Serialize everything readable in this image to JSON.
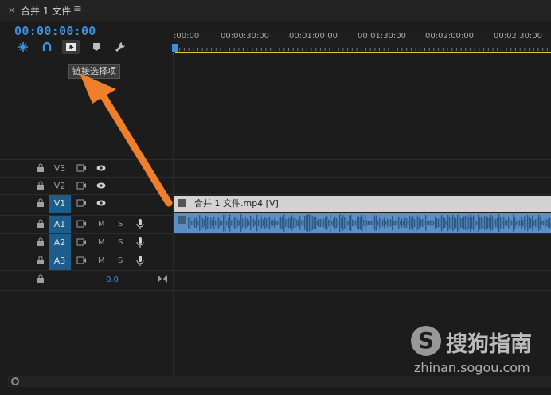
{
  "panel": {
    "close_glyph": "×",
    "sequence_title": "合并 1 文件",
    "menu_glyph": "≡",
    "timecode": "00:00:00:00"
  },
  "toolbar": {
    "icons": [
      "snap-icon",
      "ripple-magnet-icon",
      "linked-selection-icon",
      "marker-icon",
      "wrench-icon"
    ],
    "tooltip": "链接选择项"
  },
  "ruler": {
    "labels": [
      ":00:00",
      "00:00:30:00",
      "00:01:00:00",
      "00:01:30:00",
      "00:02:00:00",
      "00:02:30:00"
    ],
    "range_color": "#d6cf2c",
    "playhead_color": "#3d8fe0"
  },
  "tracks": {
    "video": [
      {
        "label": "V3",
        "active": false
      },
      {
        "label": "V2",
        "active": false
      },
      {
        "label": "V1",
        "active": true
      }
    ],
    "audio": [
      {
        "label": "A1",
        "active": true,
        "m": "M",
        "s": "S"
      },
      {
        "label": "A2",
        "active": true,
        "m": "M",
        "s": "S"
      },
      {
        "label": "A3",
        "active": true,
        "m": "M",
        "s": "S"
      }
    ],
    "master_value": "0.0"
  },
  "clips": {
    "video_label": "合并 1 文件.mp4 [V]",
    "video_fx": "fx",
    "audio_fx": "fx"
  },
  "watermark": {
    "logo_letter": "S",
    "brand": "搜狗指南",
    "url": "zhinan.sogou.com"
  },
  "annotation": {
    "arrow_color": "#ef7f2a"
  }
}
